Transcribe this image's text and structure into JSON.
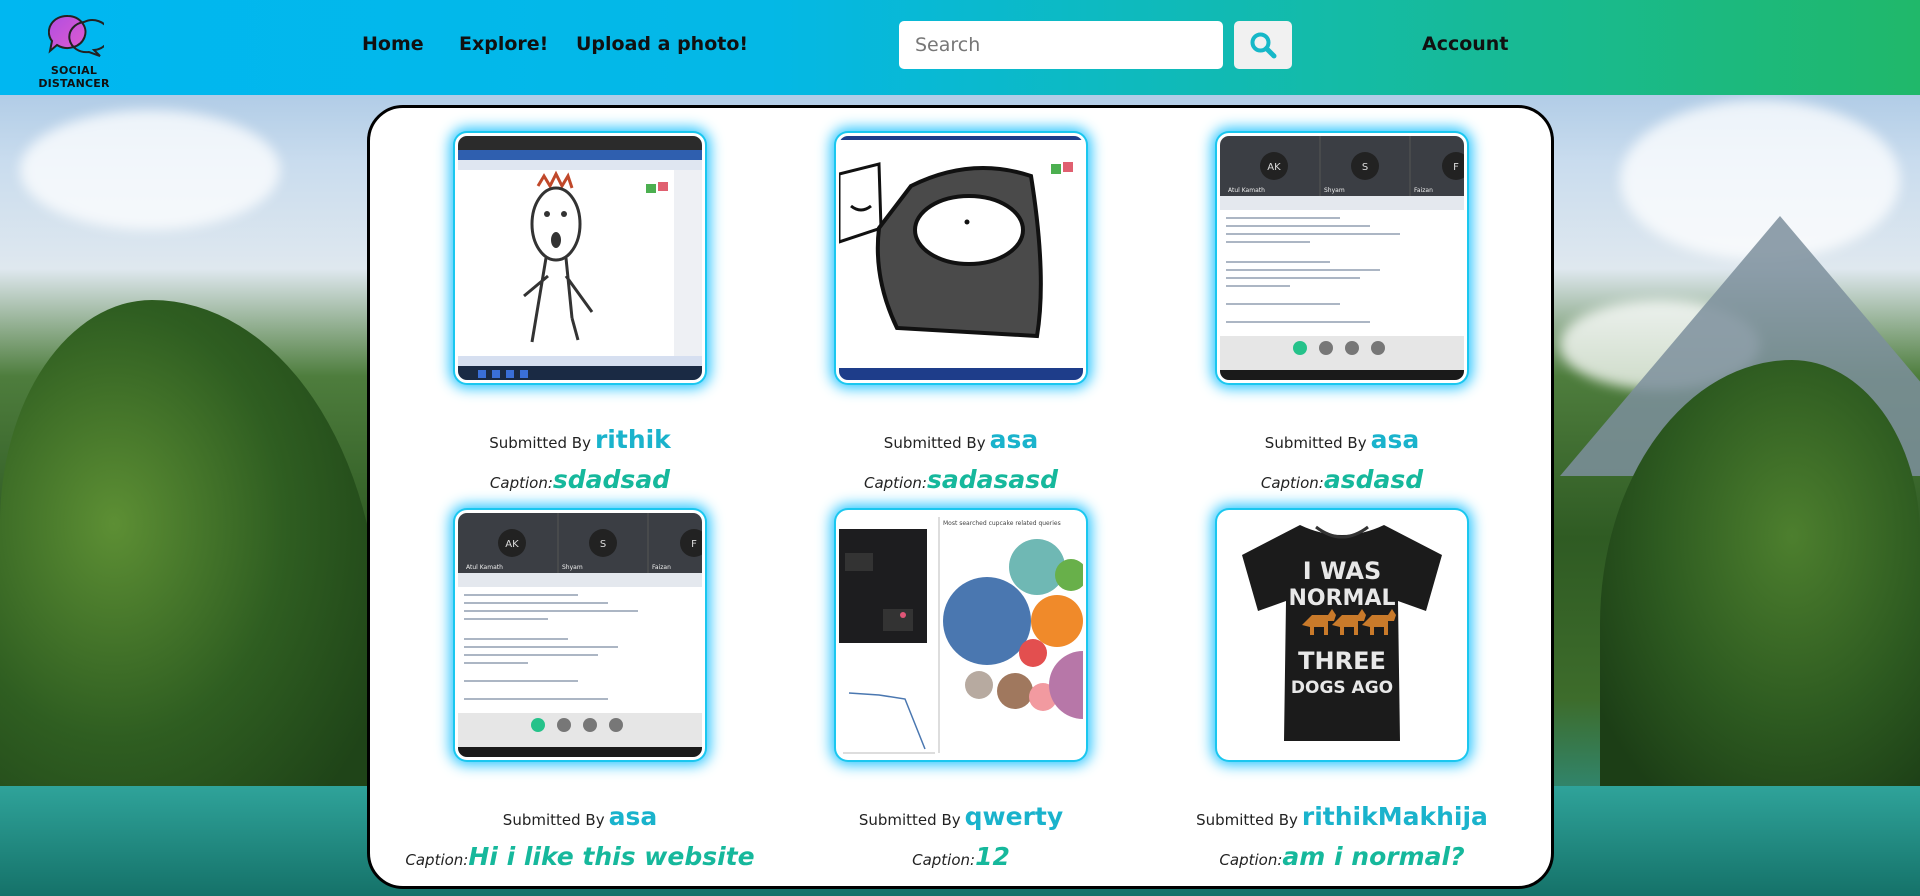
{
  "brand": {
    "name": "SOCIAL DISTANCER",
    "colors": {
      "nav_start": "#00b7f1",
      "nav_end": "#20b86a",
      "username": "#1ab3cc",
      "caption": "#16b89c",
      "glow": "#23c4ff"
    }
  },
  "nav": {
    "links": [
      {
        "label": "Home"
      },
      {
        "label": "Explore!"
      },
      {
        "label": "Upload a photo!"
      }
    ],
    "search_placeholder": "Search",
    "search_icon": "search-icon",
    "account_label": "Account"
  },
  "posts": [
    {
      "submitted_label": "Submitted By",
      "user": "rithik",
      "caption_label": "Caption:",
      "caption": "sdadsad",
      "image": "paint-drawing-screenshot"
    },
    {
      "submitted_label": "Submitted By",
      "user": "asa",
      "caption_label": "Caption:",
      "caption": "sadasasd",
      "image": "paint-drawing-screenshot"
    },
    {
      "submitted_label": "Submitted By",
      "user": "asa",
      "caption_label": "Caption:",
      "caption": "asdasd",
      "image": "video-call-code-screenshot"
    },
    {
      "submitted_label": "Submitted By",
      "user": "asa",
      "caption_label": "Caption:",
      "caption": "Hi i like this website",
      "image": "video-call-code-screenshot"
    },
    {
      "submitted_label": "Submitted By",
      "user": "qwerty",
      "caption_label": "Caption:",
      "caption": "12",
      "image": "bubble-chart-screenshot"
    },
    {
      "submitted_label": "Submitted By",
      "user": "rithikMakhija",
      "caption_label": "Caption:",
      "caption": "am i normal?",
      "image": "tshirt-photo"
    }
  ],
  "thumb_text": {
    "tshirt_lines": [
      "I WAS",
      "NORMAL",
      "THREE",
      "DOGS AGO"
    ],
    "call_participants": [
      "AK",
      "S",
      "F"
    ],
    "call_names": [
      "Atul Kamath",
      "Shyam",
      "Faizan"
    ],
    "chart_title": "Most searched cupcake related queries"
  }
}
